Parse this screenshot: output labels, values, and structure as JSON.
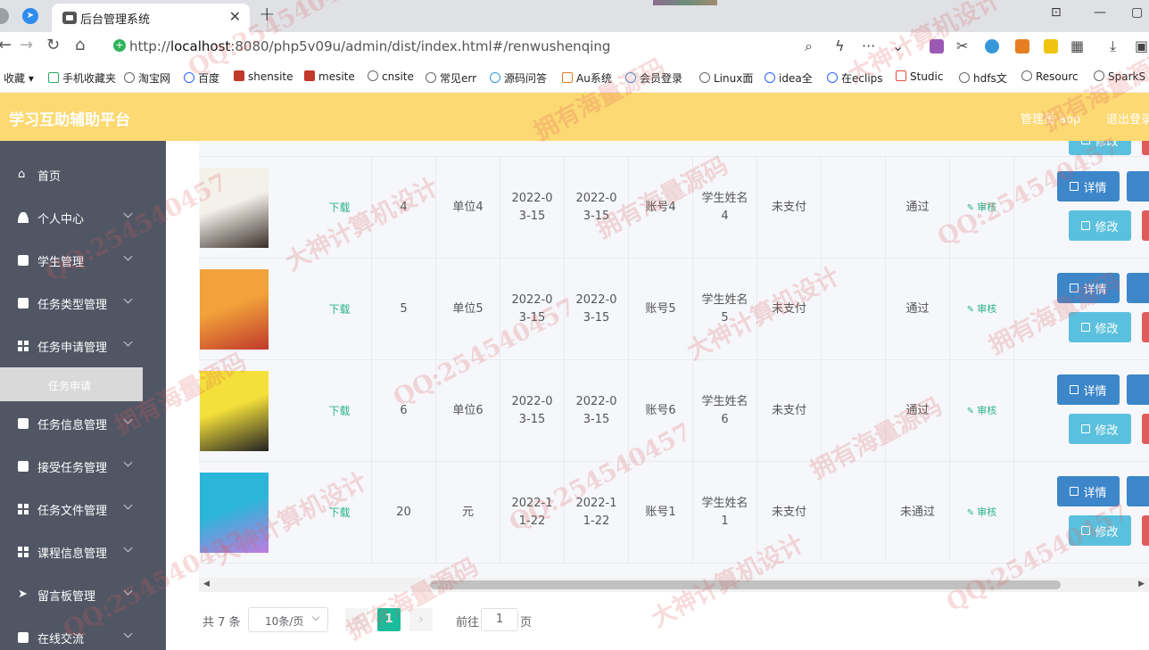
{
  "browser": {
    "tab_title": "后台管理系统",
    "url_prefix": "http://",
    "url_host": "localhost",
    "url_rest": ":8080/php5v09u/admin/dist/index.html#/renwushenqing",
    "bookmarks": [
      "收藏",
      "手机收藏夹",
      "淘宝网",
      "百度",
      "shensite",
      "mesite",
      "cnsite",
      "常见err",
      "源码问答",
      "Au系统",
      "会员登录",
      "Linux面",
      "idea全",
      "在eclips",
      "Studic",
      "hdfs文",
      "Resourc",
      "SparkS"
    ]
  },
  "header": {
    "title": "学习互助辅助平台",
    "user": "管理员 aop",
    "logout": "退出登录"
  },
  "sidebar": {
    "items": [
      {
        "label": "首页",
        "has_arrow": false
      },
      {
        "label": "个人中心",
        "has_arrow": true
      },
      {
        "label": "学生管理",
        "has_arrow": true
      },
      {
        "label": "任务类型管理",
        "has_arrow": true
      },
      {
        "label": "任务申请管理",
        "has_arrow": true
      },
      {
        "label": "任务信息管理",
        "has_arrow": true
      },
      {
        "label": "接受任务管理",
        "has_arrow": true
      },
      {
        "label": "任务文件管理",
        "has_arrow": true
      },
      {
        "label": "课程信息管理",
        "has_arrow": true
      },
      {
        "label": "留言板管理",
        "has_arrow": true
      },
      {
        "label": "在线交流",
        "has_arrow": true
      }
    ],
    "active_sub": "任务申请"
  },
  "table": {
    "action_detail": "详情",
    "action_edit": "修改",
    "action_edit_partial": "修改",
    "rows": [
      {
        "file": "下载",
        "num": "4",
        "unit": "单位4",
        "start": "2022-03-15",
        "end": "2022-03-15",
        "account": "账号4",
        "name": "学生姓名4",
        "pay": "未支付",
        "status": "通过",
        "audit": "审核",
        "cover_colors": [
          "#f4f1ea",
          "#3a2f2a"
        ]
      },
      {
        "file": "下载",
        "num": "5",
        "unit": "单位5",
        "start": "2022-03-15",
        "end": "2022-03-15",
        "account": "账号5",
        "name": "学生姓名5",
        "pay": "未支付",
        "status": "通过",
        "audit": "审核",
        "cover_colors": [
          "#f2a23a",
          "#c0392b"
        ]
      },
      {
        "file": "下载",
        "num": "6",
        "unit": "单位6",
        "start": "2022-03-15",
        "end": "2022-03-15",
        "account": "账号6",
        "name": "学生姓名6",
        "pay": "未支付",
        "status": "通过",
        "audit": "审核",
        "cover_colors": [
          "#f4e03a",
          "#222222"
        ]
      },
      {
        "file": "下载",
        "num": "20",
        "unit": "元",
        "start": "2022-11-22",
        "end": "2022-11-22",
        "account": "账号1",
        "name": "学生姓名1",
        "pay": "未支付",
        "status": "未通过",
        "audit": "审核",
        "cover_colors": [
          "#2bb5d9",
          "#c07be0"
        ]
      }
    ]
  },
  "pagination": {
    "total": "共 7 条",
    "page_size": "10条/页",
    "current": "1",
    "goto_label": "前往",
    "goto_value": "1",
    "page_suffix": "页"
  },
  "watermark": [
    "QQ:254540457",
    "拥有海量源码",
    "大神计算机设计"
  ]
}
